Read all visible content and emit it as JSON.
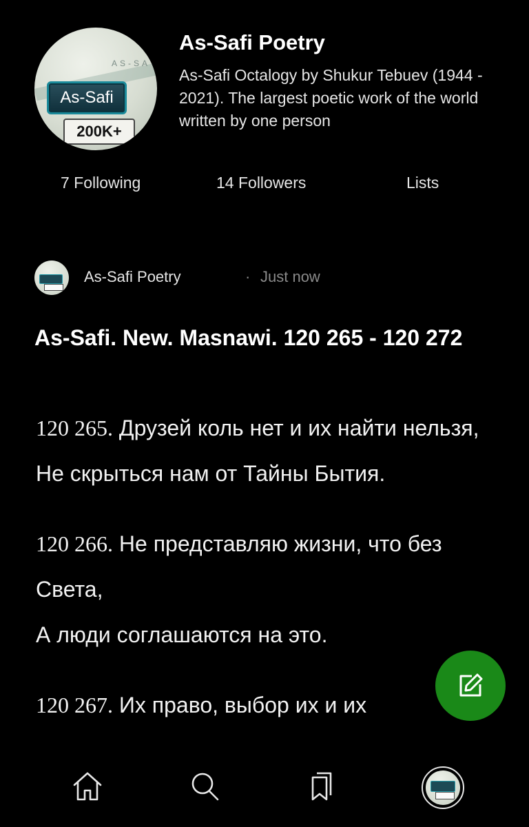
{
  "profile": {
    "name": "As-Safi Poetry",
    "bio": "As-Safi Octalogy by Shukur Tebuev (1944 - 2021). The largest poetic work of the world written by one person",
    "avatar": {
      "badge_text": "As-Safi",
      "count_text": "200K+",
      "faint_text": "AS-SA"
    },
    "following": "7 Following",
    "followers": "14 Followers",
    "lists": "Lists"
  },
  "post": {
    "author": "As-Safi Poetry",
    "separator": "·",
    "time": "Just now",
    "title": "As-Safi. New. Masnawi. 120 265 - 120 272",
    "verses": [
      {
        "number": "120 265.",
        "lines": [
          "Друзей коль нет и их найти нельзя,",
          "Не скрыться нам от Тайны Бытия."
        ]
      },
      {
        "number": "120 266.",
        "lines": [
          "Не представляю жизни, что без Света,",
          "А люди соглашаются на это."
        ]
      },
      {
        "number": "120 267.",
        "lines": [
          "Их право, выбор их и их"
        ]
      }
    ]
  },
  "fab": {
    "icon": "edit-icon",
    "color": "#1a8918"
  },
  "bottom_nav": {
    "items": [
      "home-icon",
      "search-icon",
      "bookmarks-icon",
      "profile-avatar"
    ]
  }
}
